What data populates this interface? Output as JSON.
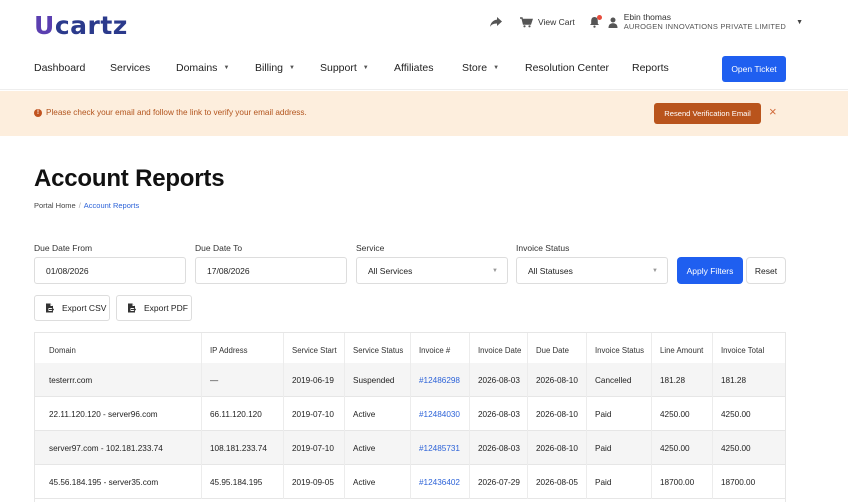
{
  "header": {
    "logo_u": "U",
    "logo_rest": "cartz",
    "view_cart": "View Cart",
    "user_name": "Ebin thomas",
    "user_company": "AUROGEN INNOVATIONS PRIVATE LIMITED"
  },
  "nav": {
    "items": [
      {
        "label": "Dashboard",
        "dropdown": false
      },
      {
        "label": "Services",
        "dropdown": false
      },
      {
        "label": "Domains",
        "dropdown": true
      },
      {
        "label": "Billing",
        "dropdown": true
      },
      {
        "label": "Support",
        "dropdown": true
      },
      {
        "label": "Affiliates",
        "dropdown": false
      },
      {
        "label": "Store",
        "dropdown": true
      },
      {
        "label": "Resolution Center",
        "dropdown": false
      },
      {
        "label": "Reports",
        "dropdown": false
      }
    ],
    "open_ticket": "Open Ticket"
  },
  "alert": {
    "text": "Please check your email and follow the link to verify your email address.",
    "resend": "Resend Verification Email",
    "close": "×"
  },
  "page": {
    "title": "Account Reports",
    "breadcrumb_home": "Portal Home",
    "breadcrumb_current": "Account Reports"
  },
  "filters": {
    "due_from_label": "Due Date From",
    "due_from_value": "01/08/2026",
    "due_to_label": "Due Date To",
    "due_to_value": "17/08/2026",
    "service_label": "Service",
    "service_value": "All Services",
    "invoice_status_label": "Invoice Status",
    "invoice_status_value": "All Statuses",
    "apply": "Apply Filters",
    "reset": "Reset"
  },
  "exports": {
    "csv": "Export CSV",
    "pdf": "Export PDF"
  },
  "table": {
    "columns": [
      "Domain",
      "IP Address",
      "Service Start",
      "Service Status",
      "Invoice #",
      "Invoice Date",
      "Due Date",
      "Invoice Status",
      "Line Amount",
      "Invoice Total"
    ],
    "rows": [
      [
        "testerrr.com",
        "—",
        "2019-06-19",
        "Suspended",
        "#12486298",
        "2026-08-03",
        "2026-08-10",
        "Cancelled",
        "181.28",
        "181.28"
      ],
      [
        "22.11.120.120 - server96.com",
        "66.11.120.120",
        "2019-07-10",
        "Active",
        "#12484030",
        "2026-08-03",
        "2026-08-10",
        "Paid",
        "4250.00",
        "4250.00"
      ],
      [
        "server97.com - 102.181.233.74",
        "108.181.233.74",
        "2019-07-10",
        "Active",
        "#12485731",
        "2026-08-03",
        "2026-08-10",
        "Paid",
        "4250.00",
        "4250.00"
      ],
      [
        "45.56.184.195 - server35.com",
        "45.95.184.195",
        "2019-09-05",
        "Active",
        "#12436402",
        "2026-07-29",
        "2026-08-05",
        "Paid",
        "18700.00",
        "18700.00"
      ]
    ]
  },
  "colors": {
    "primary": "#1f5ff0",
    "alert_bg": "#fdeedd",
    "alert_text": "#b2541d",
    "resend_bg": "#b9541c",
    "link": "#2d63d8"
  }
}
